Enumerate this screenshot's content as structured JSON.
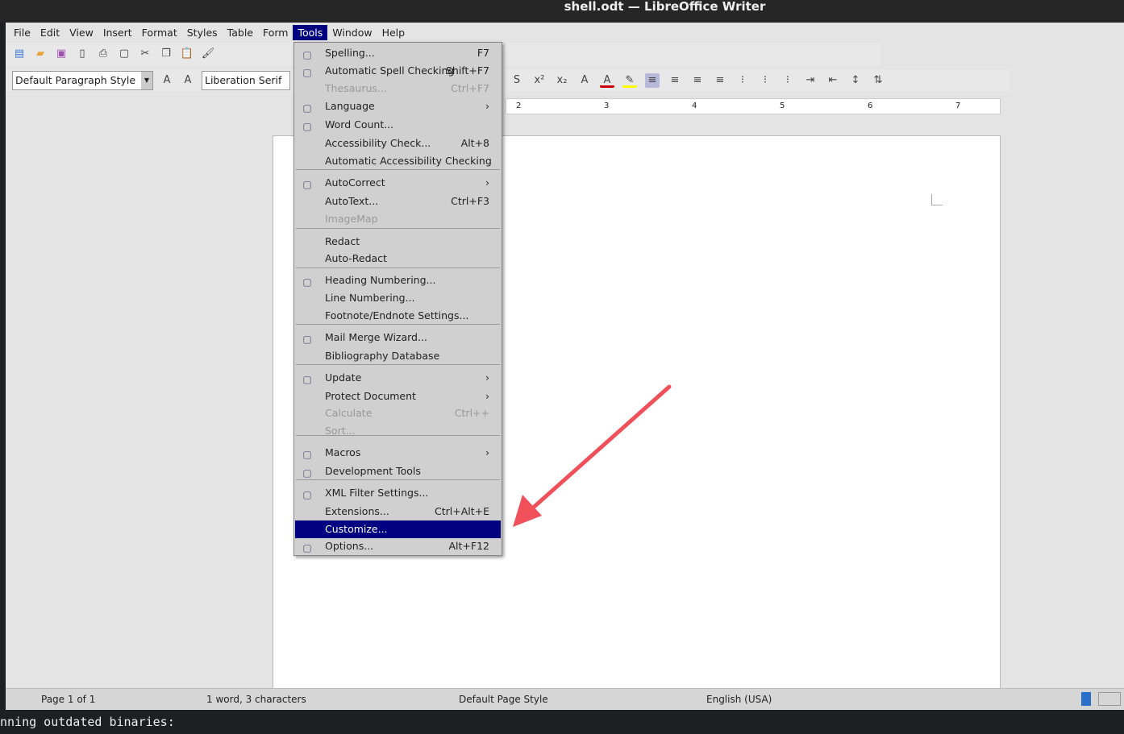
{
  "title": "shell.odt — LibreOffice Writer",
  "menubar": [
    "File",
    "Edit",
    "View",
    "Insert",
    "Format",
    "Styles",
    "Table",
    "Form",
    "Tools",
    "Window",
    "Help"
  ],
  "toolbar": {
    "paragraph_style": "Default Paragraph Style",
    "font_name": "Liberation Serif"
  },
  "ruler": [
    "2",
    "3",
    "4",
    "5",
    "6",
    "7"
  ],
  "tools_menu": [
    {
      "label": "Spelling...",
      "shortcut": "F7",
      "icon": "spelling-icon"
    },
    {
      "label": "Automatic Spell Checking",
      "shortcut": "Shift+F7",
      "icon": "auto-spell-icon"
    },
    {
      "label": "Thesaurus...",
      "shortcut": "Ctrl+F7",
      "disabled": true
    },
    {
      "label": "Language",
      "shortcut": "›",
      "icon": "language-icon"
    },
    {
      "label": "Word Count...",
      "shortcut": "",
      "icon": "word-count-icon"
    },
    {
      "label": "Accessibility Check...",
      "shortcut": "Alt+8"
    },
    {
      "label": "Automatic Accessibility Checking",
      "shortcut": ""
    },
    {
      "label": "AutoCorrect",
      "shortcut": "›",
      "icon": "autocorrect-icon"
    },
    {
      "label": "AutoText...",
      "shortcut": "Ctrl+F3"
    },
    {
      "label": "ImageMap",
      "shortcut": "",
      "disabled": true
    },
    {
      "label": "Redact",
      "shortcut": ""
    },
    {
      "label": "Auto-Redact",
      "shortcut": ""
    },
    {
      "label": "Heading Numbering...",
      "shortcut": "",
      "icon": "heading-numbering-icon"
    },
    {
      "label": "Line Numbering...",
      "shortcut": ""
    },
    {
      "label": "Footnote/Endnote Settings...",
      "shortcut": ""
    },
    {
      "label": "Mail Merge Wizard...",
      "shortcut": "",
      "icon": "mail-merge-icon"
    },
    {
      "label": "Bibliography Database",
      "shortcut": ""
    },
    {
      "label": "Update",
      "shortcut": "›",
      "icon": "update-icon"
    },
    {
      "label": "Protect Document",
      "shortcut": "›"
    },
    {
      "label": "Calculate",
      "shortcut": "Ctrl++",
      "disabled": true
    },
    {
      "label": "Sort...",
      "shortcut": "",
      "disabled": true
    },
    {
      "label": "Macros",
      "shortcut": "›",
      "icon": "macros-icon"
    },
    {
      "label": "Development Tools",
      "shortcut": "",
      "icon": "dev-tools-icon"
    },
    {
      "label": "XML Filter Settings...",
      "shortcut": "",
      "icon": "xml-filter-icon"
    },
    {
      "label": "Extensions...",
      "shortcut": "Ctrl+Alt+E"
    },
    {
      "label": "Customize...",
      "shortcut": "",
      "highlighted": true
    },
    {
      "label": "Options...",
      "shortcut": "Alt+F12",
      "icon": "options-gear-icon"
    }
  ],
  "status": {
    "page": "Page 1 of 1",
    "words": "1 word, 3 characters",
    "page_style": "Default Page Style",
    "language": "English (USA)"
  },
  "terminal": "nning outdated binaries:",
  "colors": {
    "highlight": "#000080",
    "arrow": "#f0505a"
  }
}
